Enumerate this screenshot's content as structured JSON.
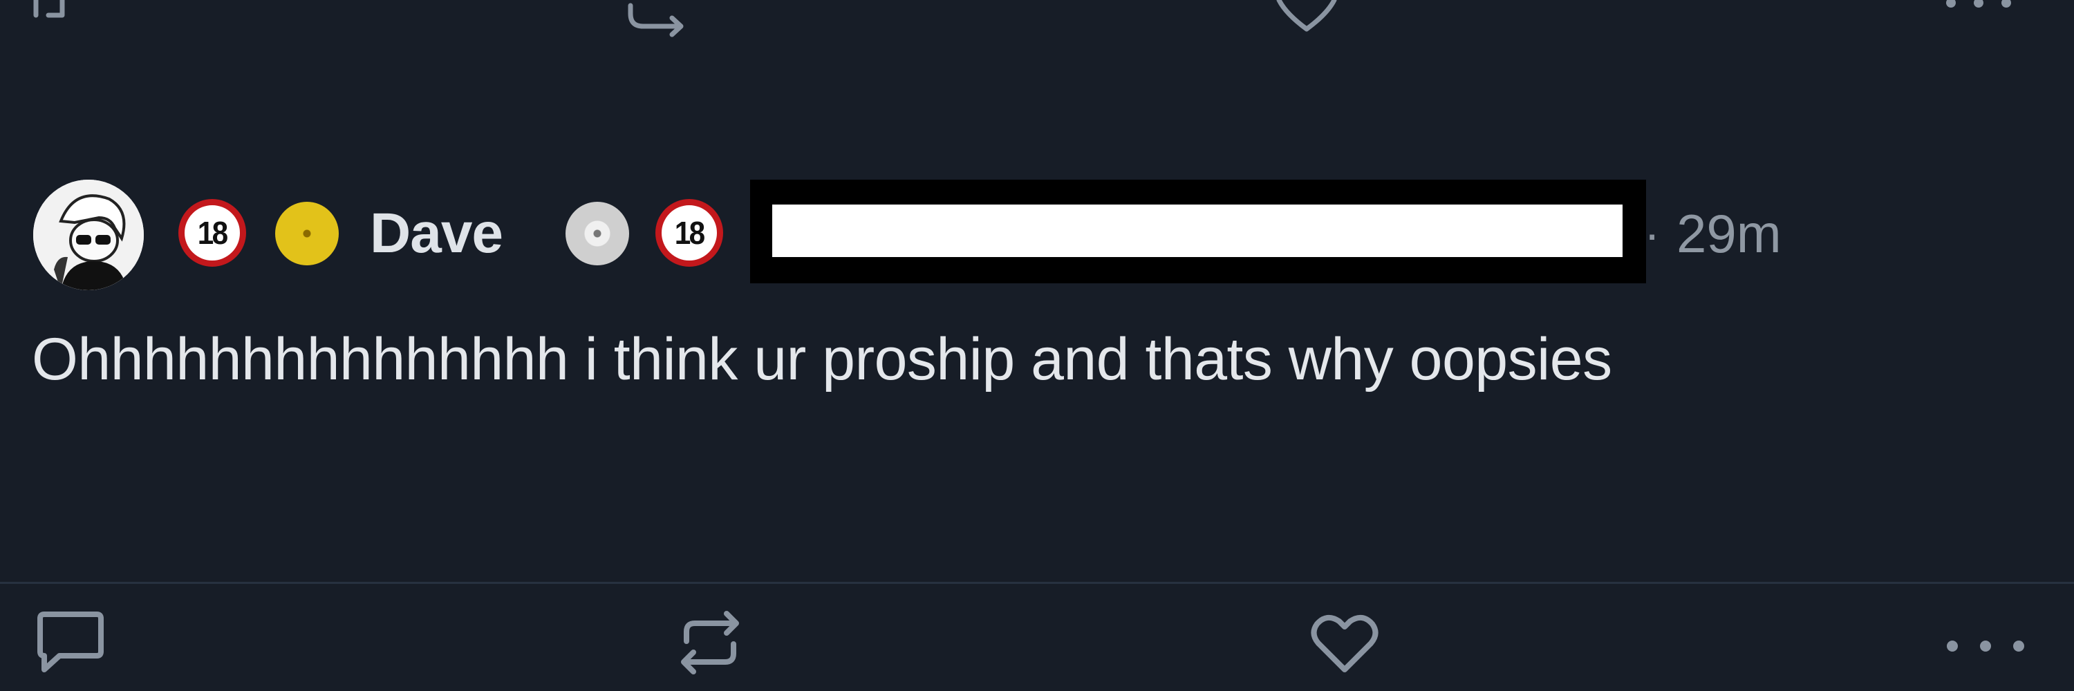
{
  "post": {
    "display_name": "Dave",
    "timestamp": "29m",
    "separator": "·",
    "body": "Ohhhhhhhhhhhhhhh i think ur proship and thats why oopsies",
    "badges": [
      {
        "name": "18-plus-badge",
        "text": "18"
      },
      {
        "name": "gold-disc-badge"
      },
      {
        "name": "silver-disc-badge"
      },
      {
        "name": "18-plus-badge",
        "text": "18"
      }
    ]
  },
  "colors": {
    "background": "#171d27",
    "text": "#e4e7eb",
    "muted": "#8f98a3",
    "badge_red": "#c3181c",
    "gold_disc": "#e2c21a",
    "divider": "#273140"
  },
  "icons": [
    "reply-icon",
    "repost-icon",
    "like-icon",
    "more-icon"
  ]
}
